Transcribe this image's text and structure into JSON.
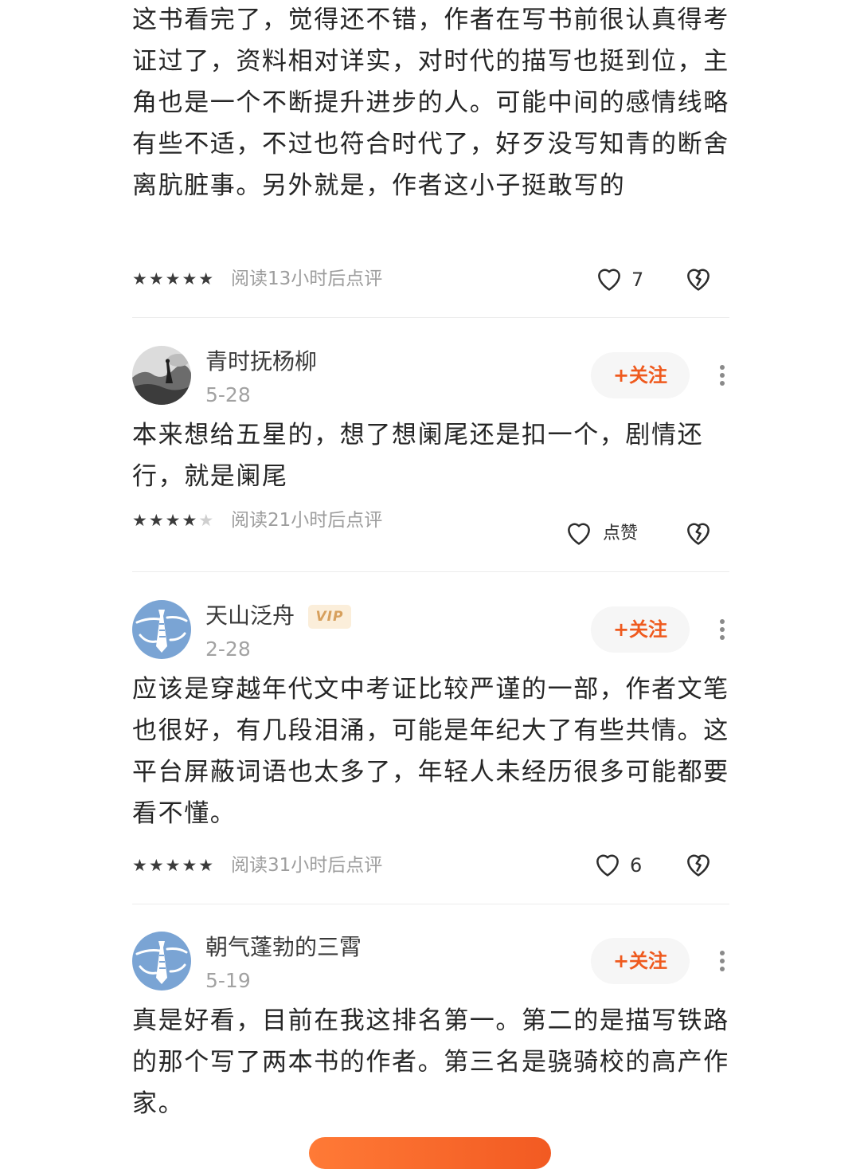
{
  "reviews": [
    {
      "text": "这书看完了，觉得还不错，作者在写书前很认真得考证过了，资料相对详实，对时代的描写也挺到位，主角也是一个不断提升进步的人。可能中间的感情线略有些不适，不过也符合时代了，好歹没写知青的断舍离肮脏事。另外就是，作者这小子挺敢写的",
      "stars_filled": 5,
      "read_note": "阅读13小时后点评",
      "like_label": "7"
    },
    {
      "username": "青时抚杨柳",
      "date": "5-28",
      "follow_label": "+关注",
      "avatar_icon": "ink-painting-avatar",
      "text": "本来想给五星的，想了想阑尾还是扣一个，剧情还行，就是阑尾",
      "stars_filled": 4,
      "read_note": "阅读21小时后点评",
      "like_label": "点赞"
    },
    {
      "username": "天山泛舟",
      "vip_label": "VIP",
      "date": "2-28",
      "follow_label": "+关注",
      "avatar_icon": "default-blue-avatar",
      "text": "应该是穿越年代文中考证比较严谨的一部，作者文笔也很好，有几段泪涌，可能是年纪大了有些共情。这平台屏蔽词语也太多了，年轻人未经历很多可能都要看不懂。",
      "stars_filled": 5,
      "read_note": "阅读31小时后点评",
      "like_label": "6"
    },
    {
      "username": "朝气蓬勃的三霄",
      "date": "5-19",
      "follow_label": "+关注",
      "avatar_icon": "default-blue-avatar",
      "text": "真是好看，目前在我这排名第一。第二的是描写铁路的那个写了两本书的作者。第三名是骁骑校的高产作家。"
    }
  ],
  "icons": {
    "like": "heart-icon",
    "dislike": "broken-heart-icon",
    "more": "more-vertical-icon",
    "star": "star-icon"
  },
  "colors": {
    "accent": "#ef5a1e",
    "vip_badge_bg": "#fbeeda",
    "vip_badge_text": "#d7a05d",
    "avatar_blue": "#6f9ccf"
  }
}
